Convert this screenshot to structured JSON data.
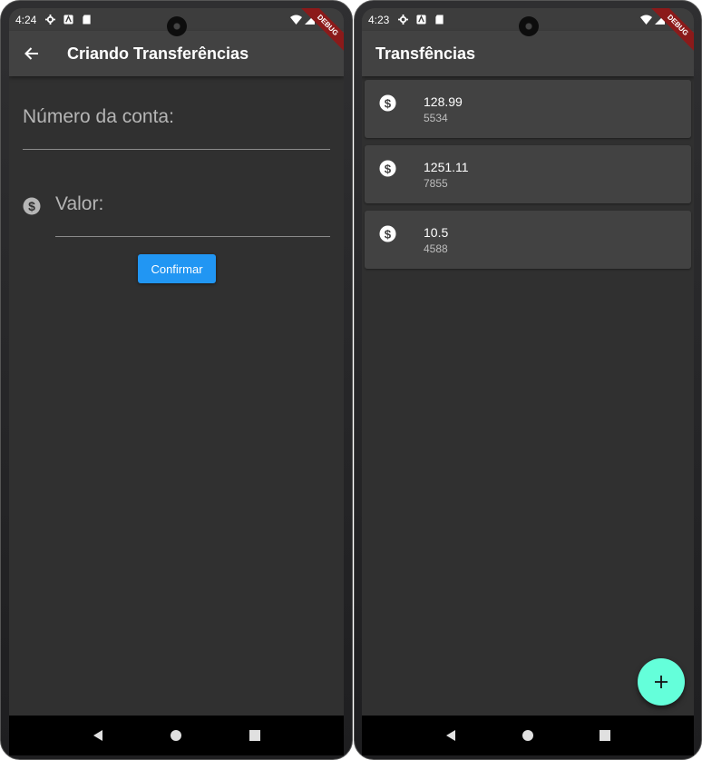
{
  "left_screen": {
    "status": {
      "time": "4:24"
    },
    "debug_label": "DEBUG",
    "app_bar": {
      "title": "Criando Transferências"
    },
    "form": {
      "account_label": "Número da conta:",
      "value_label": "Valor:",
      "confirm_label": "Confirmar"
    }
  },
  "right_screen": {
    "status": {
      "time": "4:23"
    },
    "debug_label": "DEBUG",
    "app_bar": {
      "title": "Transfências"
    },
    "transfers": [
      {
        "value": "128.99",
        "account": "5534"
      },
      {
        "value": "1251.11",
        "account": "7855"
      },
      {
        "value": "10.5",
        "account": "4588"
      }
    ],
    "fab_icon": "add-icon"
  },
  "colors": {
    "background": "#303030",
    "app_bar": "#424242",
    "card": "#424242",
    "primary_button": "#2196f3",
    "fab": "#64ffda",
    "debug_ribbon": "#8b1a1a"
  }
}
